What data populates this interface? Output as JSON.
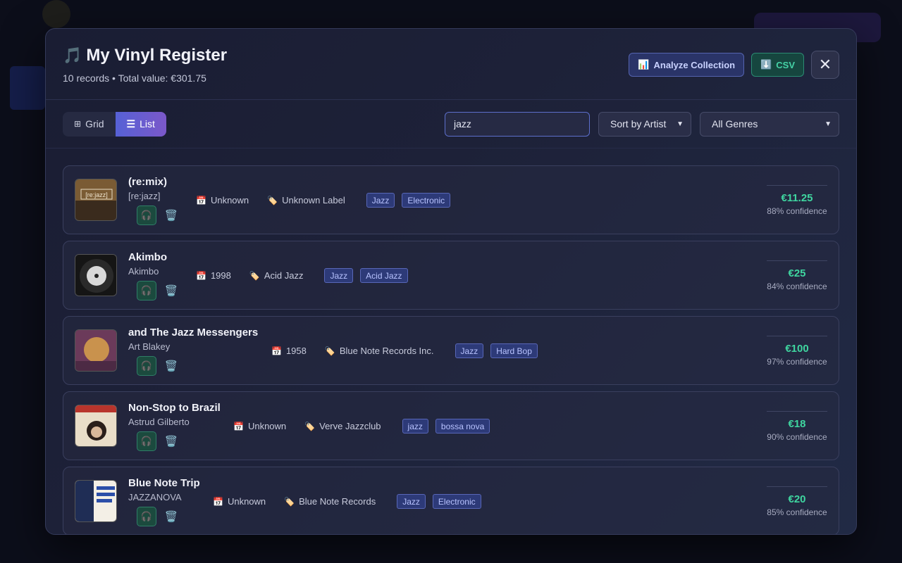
{
  "header": {
    "icon": "music-note-icon",
    "title": "My Vinyl Register",
    "subtitle": "10 records • Total value: €301.75",
    "analyze_label": "Analyze Collection",
    "csv_label": "CSV"
  },
  "toolbar": {
    "grid_label": "Grid",
    "list_label": "List",
    "search_value": "jazz",
    "sort_selected": "Sort by Artist",
    "genre_selected": "All Genres"
  },
  "records": [
    {
      "title": "(re:mix)",
      "artist": "[re:jazz]",
      "year": "Unknown",
      "label": "Unknown Label",
      "genres": [
        "Jazz",
        "Electronic"
      ],
      "price": "€11.25",
      "confidence": "88% confidence"
    },
    {
      "title": "Akimbo",
      "artist": "Akimbo",
      "year": "1998",
      "label": "Acid Jazz",
      "genres": [
        "Jazz",
        "Acid Jazz"
      ],
      "price": "€25",
      "confidence": "84% confidence"
    },
    {
      "title": "and The Jazz Messengers",
      "artist": "Art Blakey",
      "year": "1958",
      "label": "Blue Note Records Inc.",
      "genres": [
        "Jazz",
        "Hard Bop"
      ],
      "price": "€100",
      "confidence": "97% confidence"
    },
    {
      "title": "Non-Stop to Brazil",
      "artist": "Astrud Gilberto",
      "year": "Unknown",
      "label": "Verve Jazzclub",
      "genres": [
        "jazz",
        "bossa nova"
      ],
      "price": "€18",
      "confidence": "90% confidence"
    },
    {
      "title": "Blue Note Trip",
      "artist": "JAZZANOVA",
      "year": "Unknown",
      "label": "Blue Note Records",
      "genres": [
        "Jazz",
        "Electronic"
      ],
      "price": "€20",
      "confidence": "85% confidence"
    }
  ],
  "colors": {
    "accent": "#5661d6",
    "price_green": "#3fd6a0",
    "tag_bg": "#2d3a78"
  }
}
